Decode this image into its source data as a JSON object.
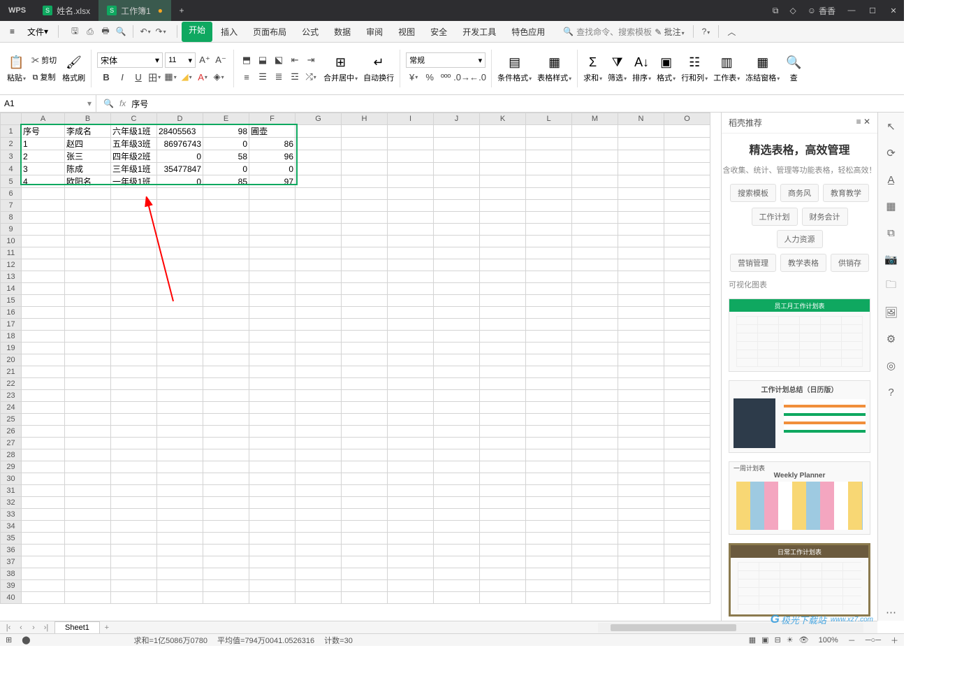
{
  "titlebar": {
    "app": "WPS",
    "tabs": [
      {
        "label": "姓名.xlsx",
        "active": false
      },
      {
        "label": "工作簿1",
        "active": true
      }
    ],
    "user": "香香"
  },
  "menubar": {
    "file": "文件",
    "tabs": [
      "开始",
      "插入",
      "页面布局",
      "公式",
      "数据",
      "审阅",
      "视图",
      "安全",
      "开发工具",
      "特色应用"
    ],
    "active_tab": "开始",
    "search_placeholder": "查找命令、搜索模板",
    "annotate": "批注"
  },
  "ribbon": {
    "paste": "粘贴",
    "cut": "剪切",
    "copy": "复制",
    "format_painter": "格式刷",
    "font_name": "宋体",
    "font_size": "11",
    "merge": "合并居中",
    "wrap": "自动换行",
    "num_format": "常规",
    "cond_fmt": "条件格式",
    "table_style": "表格样式",
    "sum": "求和",
    "filter": "筛选",
    "sort": "排序",
    "format": "格式",
    "rowcol": "行和列",
    "worksheet": "工作表",
    "freeze": "冻结窗格",
    "find": "查"
  },
  "refbar": {
    "name": "A1",
    "fx": "fx",
    "formula": "序号"
  },
  "columns": [
    "A",
    "B",
    "C",
    "D",
    "E",
    "F",
    "G",
    "H",
    "I",
    "J",
    "K",
    "L",
    "M",
    "N",
    "O"
  ],
  "rows_count": 40,
  "cells": [
    {
      "A": "序号",
      "B": "李成名",
      "C": "六年级1班",
      "D": "28405563",
      "E": "98",
      "F": "圃壶"
    },
    {
      "A": "1",
      "B": "赵四",
      "C": "五年级3班",
      "D": "86976743",
      "E": "0",
      "F": "86"
    },
    {
      "A": "2",
      "B": "张三",
      "C": "四年级2班",
      "D": "0",
      "E": "58",
      "F": "96"
    },
    {
      "A": "3",
      "B": "陈成",
      "C": "三年级1班",
      "D": "35477847",
      "E": "0",
      "F": "0"
    },
    {
      "A": "4",
      "B": "欧阳名",
      "C": "一年级1班",
      "D": "0",
      "E": "85",
      "F": "97"
    }
  ],
  "rpanel": {
    "head": "稻壳推荐",
    "title": "精选表格，高效管理",
    "subtitle": "含收集、统计、管理等功能表格，轻松高效！",
    "pills1": [
      "搜索模板",
      "商务风",
      "教育教学"
    ],
    "pills2": [
      "工作计划",
      "财务会计",
      "人力资源"
    ],
    "pills3": [
      "营销管理",
      "教学表格",
      "供销存"
    ],
    "section": "可视化图表",
    "thumbs": [
      {
        "label": "员工月工作计划表",
        "color": "#0fa860"
      },
      {
        "label": "工作计划总结（日历版）",
        "color": "#ffffff"
      },
      {
        "label": "Weekly Planner",
        "sublabel": "一周计划表",
        "color": "#ffffff"
      },
      {
        "label": "日常工作计划表",
        "color": "#6b5a3e"
      }
    ]
  },
  "sheettab": {
    "name": "Sheet1"
  },
  "statusbar": {
    "sum": "求和=1亿5086万0780",
    "avg": "平均值=794万0041.0526316",
    "count": "计数=30",
    "zoom": "100%"
  },
  "watermark": "极光下载站",
  "watermark_url": "www.xz7.com"
}
